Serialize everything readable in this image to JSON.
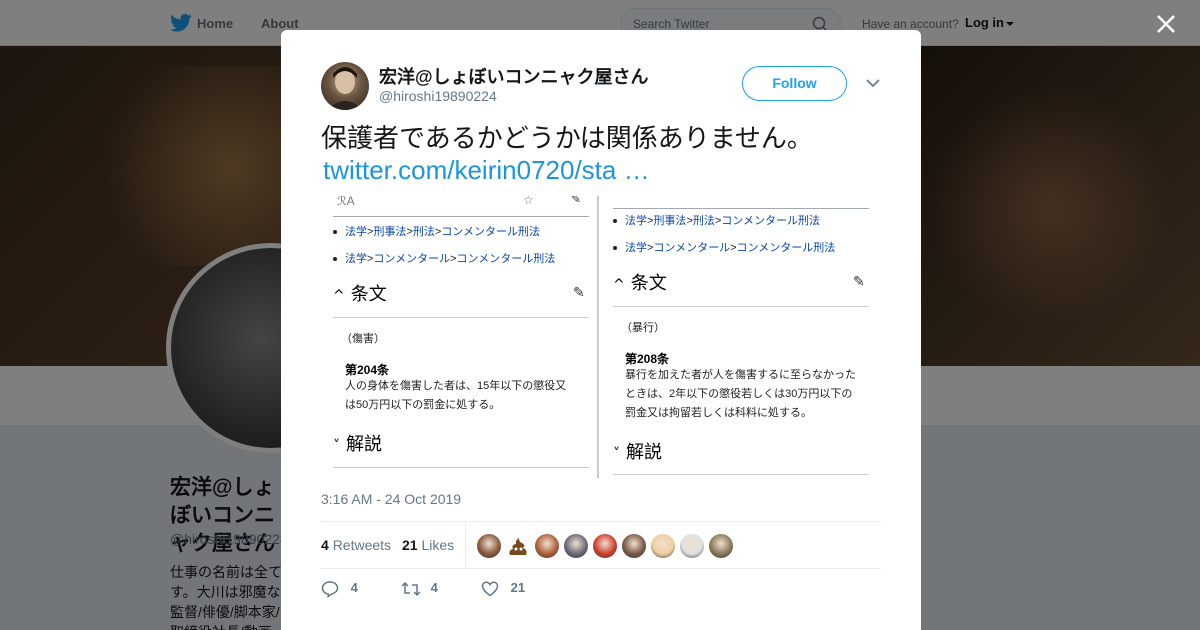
{
  "nav": {
    "home": "Home",
    "about": "About",
    "search_placeholder": "Search Twitter",
    "have_account": "Have an account?",
    "login": "Log in"
  },
  "profile_bg": {
    "name": "宏洋@しょぼいコンニャク屋さん",
    "handle": "@hiroshi19890224",
    "bio": "仕事の名前は全て す。大川は邪魔な 監督/俳優/脚本家/ 取締役社長/動画"
  },
  "tweet": {
    "author_name": "宏洋@しょぼいコンニャク屋さん",
    "author_handle": "@hiroshi19890224",
    "follow_label": "Follow",
    "text": "保護者であるかどうかは関係ありません。",
    "link": "twitter.com/keirin0720/sta …",
    "timestamp": "3:16 AM - 24 Oct 2019",
    "retweets_count": "4",
    "retweets_label": "Retweets",
    "likes_count": "21",
    "likes_label": "Likes",
    "reply_count": "4",
    "action_retweet_count": "4",
    "action_like_count": "21"
  },
  "media": {
    "left": {
      "crumb1": [
        "法学",
        "刑事法",
        "刑法",
        "コンメンタール刑法"
      ],
      "crumb2": [
        "法学",
        "コンメンタール",
        "コンメンタール刑法"
      ],
      "heading1": "条文",
      "category": "（傷害）",
      "article": "第204条",
      "body": "人の身体を傷害した者は、15年以下の懲役又は50万円以下の罰金に処する。",
      "heading2": "解説"
    },
    "right": {
      "crumb1": [
        "法学",
        "刑事法",
        "刑法",
        "コンメンタール刑法"
      ],
      "crumb2": [
        "法学",
        "コンメンタール",
        "コンメンタール刑法"
      ],
      "heading1": "条文",
      "category": "（暴行）",
      "article": "第208条",
      "body": "暴行を加えた者が人を傷害するに至らなかったときは、2年以下の懲役若しくは30万円以下の罰金又は拘留若しくは科料に処する。",
      "heading2": "解説"
    },
    "sep": ">"
  },
  "colors": {
    "accent": "#1da1f2",
    "link": "#1b95e0",
    "likers": [
      "#8a5a3c",
      "#7a4b1c",
      "#b0603a",
      "#6b6b7a",
      "#d04030",
      "#7a5a4a",
      "#f0d0a0",
      "#e0e0e0",
      "#8a7a5a"
    ]
  },
  "likers_icons": [
    "avatar",
    "poop-emoji",
    "avatar",
    "avatar",
    "avatar",
    "avatar",
    "avatar",
    "avatar",
    "avatar"
  ]
}
